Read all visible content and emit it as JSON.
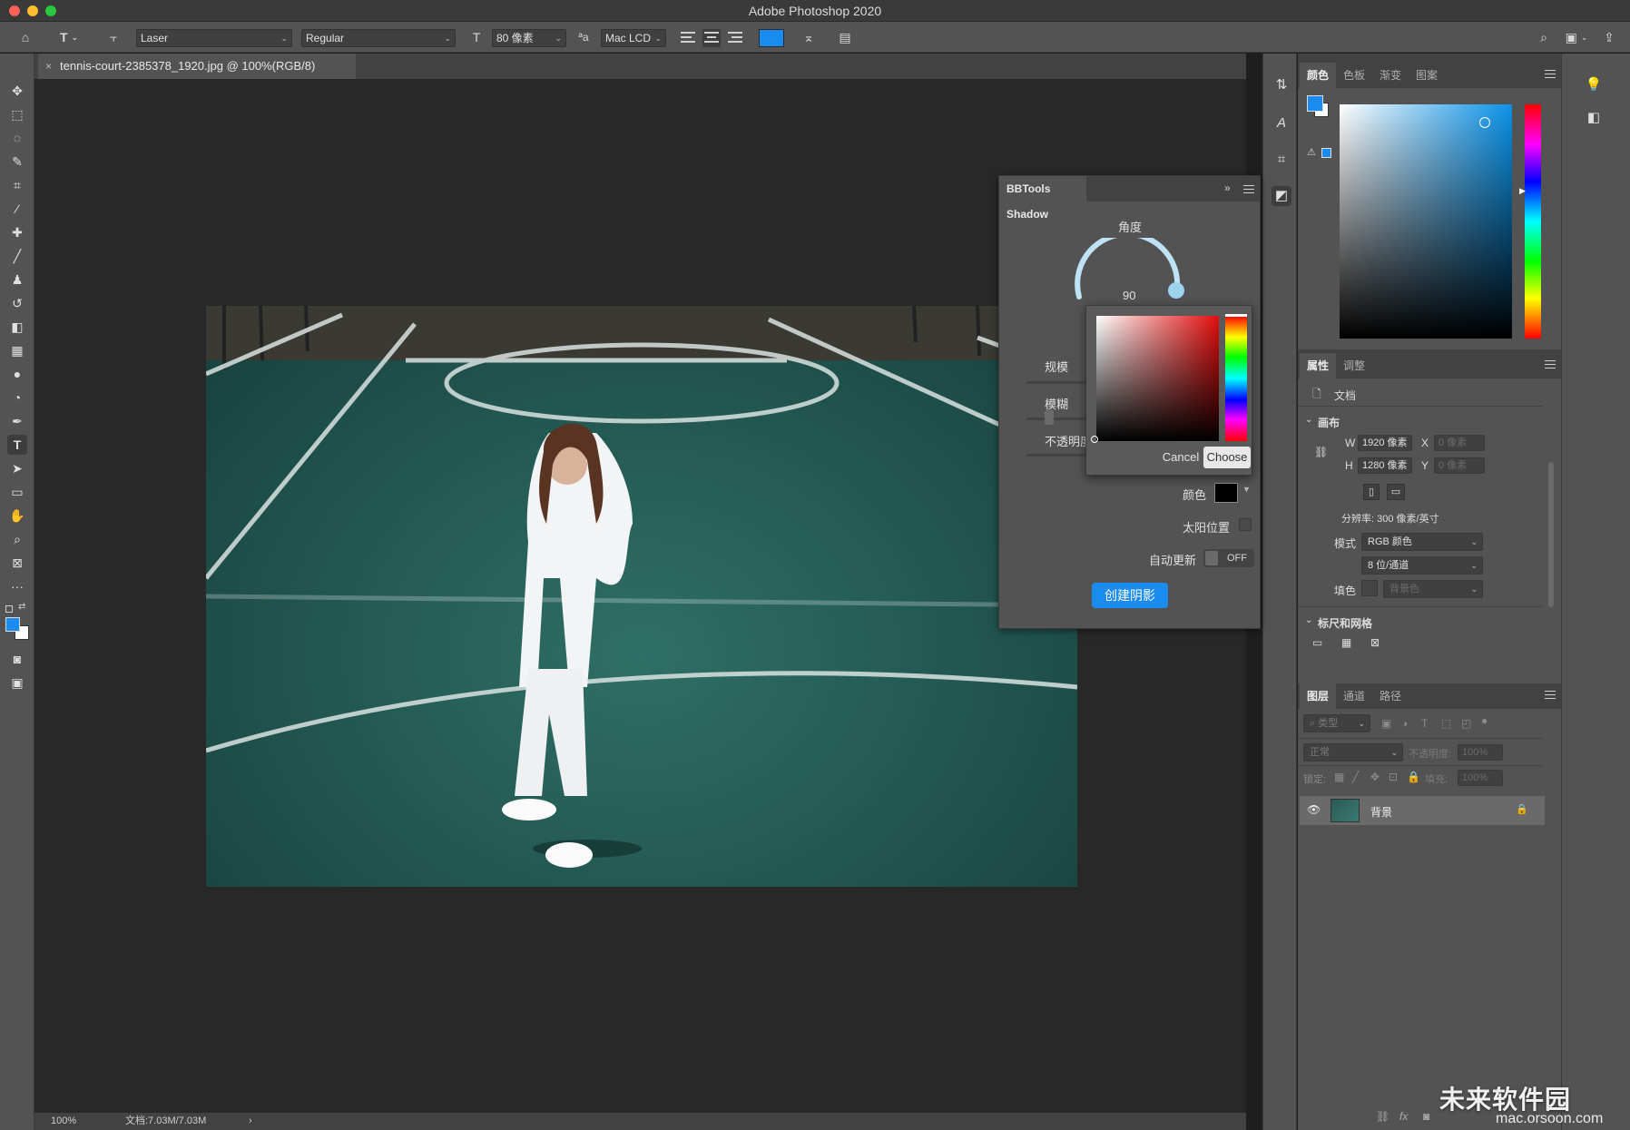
{
  "app": {
    "title": "Adobe Photoshop 2020"
  },
  "options_bar": {
    "font_family": "Laser",
    "font_style": "Regular",
    "font_size": "80 像素",
    "antialias": "Mac LCD",
    "text_color": "#1a8bf0"
  },
  "document": {
    "tab_title": "tennis-court-2385378_1920.jpg @ 100%(RGB/8)",
    "zoom": "100%",
    "doc_size": "文档:7.03M/7.03M"
  },
  "bbtools": {
    "title": "BBTools Shadow",
    "angle_label": "角度",
    "angle_value": "90",
    "scale_label": "规模",
    "blur_label": "模糊",
    "opacity_label": "不透明度",
    "color_label": "颜色",
    "sun_label": "太阳位置",
    "auto_update_label": "自动更新",
    "auto_update_state": "OFF",
    "create_button": "创建阴影",
    "shadow_color": "#000000"
  },
  "color_picker": {
    "cancel": "Cancel",
    "choose": "Choose"
  },
  "color_panel": {
    "tabs": [
      "颜色",
      "色板",
      "渐变",
      "图案"
    ],
    "foreground": "#1a8bf0",
    "background": "#ffffff"
  },
  "properties_panel": {
    "tabs": [
      "属性",
      "调整"
    ],
    "doc_label": "文档",
    "canvas_section": "画布",
    "w_label": "W",
    "w_value": "1920 像素",
    "h_label": "H",
    "h_value": "1280 像素",
    "x_label": "X",
    "x_value": "0 像素",
    "y_label": "Y",
    "y_value": "0 像素",
    "resolution": "分辨率: 300 像素/英寸",
    "mode_label": "模式",
    "mode_value": "RGB 颜色",
    "depth_value": "8 位/通道",
    "fill_label": "填色",
    "fill_value": "背景色",
    "rulers_section": "标尺和网格"
  },
  "layers_panel": {
    "tabs": [
      "图层",
      "通道",
      "路径"
    ],
    "filter_placeholder": "类型",
    "blend_mode": "正常",
    "opacity_label": "不透明度:",
    "opacity_value": "100%",
    "lock_label": "锁定:",
    "fill_label": "填充:",
    "fill_value": "100%",
    "layers": [
      {
        "name": "背景"
      }
    ]
  },
  "watermark": {
    "brand": "未来软件园",
    "url": "mac.orsoon.com"
  }
}
